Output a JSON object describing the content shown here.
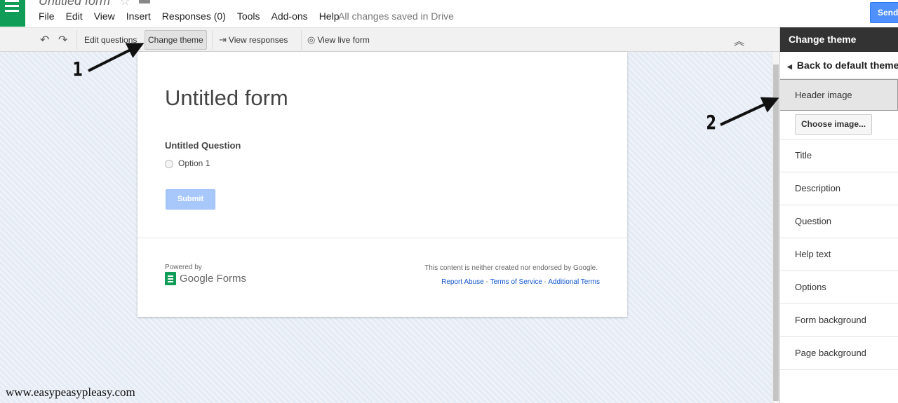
{
  "doc": {
    "title": "Untitled form",
    "save_status": "All changes saved in Drive"
  },
  "menu": [
    "File",
    "Edit",
    "View",
    "Insert",
    "Responses (0)",
    "Tools",
    "Add-ons",
    "Help"
  ],
  "send_label": "Send",
  "toolbar": {
    "edit_questions": "Edit questions",
    "change_theme": "Change theme",
    "view_responses": "View responses",
    "view_live_form": "View live form"
  },
  "form": {
    "title": "Untitled form",
    "question": "Untitled Question",
    "option": "Option 1",
    "submit": "Submit",
    "powered_by": "Powered by",
    "brand": "Google Forms",
    "disclaimer": "This content is neither created nor endorsed by Google.",
    "links": {
      "report": "Report Abuse",
      "sep": " - ",
      "terms": "Terms of Service",
      "additional": "Additional Terms"
    }
  },
  "theme_panel": {
    "header": "Change theme",
    "back": "Back to default themes",
    "header_image": "Header image",
    "choose_image": "Choose image...",
    "items": [
      "Title",
      "Description",
      "Question",
      "Help text",
      "Options",
      "Form background",
      "Page background"
    ]
  },
  "annotations": {
    "one": "1",
    "two": "2"
  },
  "watermark": "www.easypeasypleasy.com",
  "colors": {
    "brand_green": "#0f9d58",
    "send_blue": "#4d90fe",
    "canvas": "#e6ecf5",
    "panel_header": "#333333"
  }
}
